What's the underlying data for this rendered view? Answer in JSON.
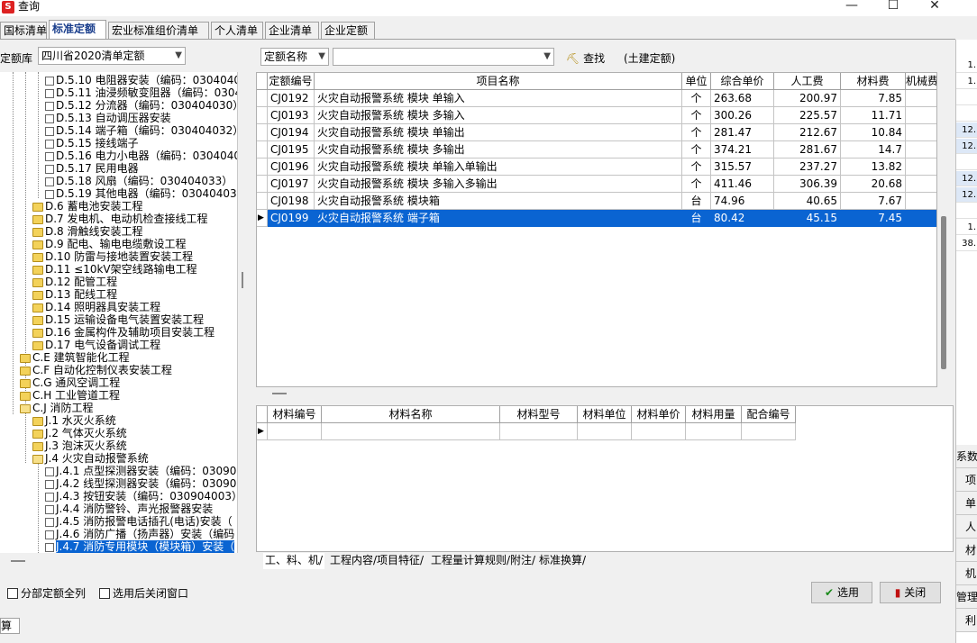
{
  "window": {
    "title": "查询",
    "controls": {
      "minimize": "—",
      "maximize": "☐",
      "close": "✕"
    }
  },
  "tabs": [
    "国标清单",
    "标准定额",
    "宏业标准组价清单",
    "个人清单",
    "企业清单",
    "企业定额"
  ],
  "active_tab_index": 1,
  "filters": {
    "library_label": "定额库",
    "library_value": "四川省2020清单定额",
    "search_field_value": "定额名称",
    "search_text_value": "",
    "find_label": "查找",
    "scope_text": "(土建定额)"
  },
  "tree": {
    "items": [
      {
        "text": "D.5.10 电阻器安装（编码：0304040",
        "level": 3,
        "icon": "doc"
      },
      {
        "text": "D.5.11 油浸频敏变阻器（编码：0304",
        "level": 3,
        "icon": "doc"
      },
      {
        "text": "D.5.12 分流器（编码：030404030）",
        "level": 3,
        "icon": "doc"
      },
      {
        "text": "D.5.13 自动调压器安装",
        "level": 3,
        "icon": "doc"
      },
      {
        "text": "D.5.14 端子箱（编码：030404032）",
        "level": 3,
        "icon": "doc"
      },
      {
        "text": "D.5.15 接线端子",
        "level": 3,
        "icon": "doc"
      },
      {
        "text": "D.5.16 电力小电器（编码：0304040",
        "level": 3,
        "icon": "doc"
      },
      {
        "text": "D.5.17 民用电器",
        "level": 3,
        "icon": "doc"
      },
      {
        "text": "D.5.18 风扇（编码：030404033）",
        "level": 3,
        "icon": "doc"
      },
      {
        "text": "D.5.19 其他电器（编码：030404036",
        "level": 3,
        "icon": "doc"
      },
      {
        "text": "D.6 蓄电池安装工程",
        "level": 2,
        "icon": "folder"
      },
      {
        "text": "D.7 发电机、电动机检查接线工程",
        "level": 2,
        "icon": "folder"
      },
      {
        "text": "D.8 滑触线安装工程",
        "level": 2,
        "icon": "folder"
      },
      {
        "text": "D.9 配电、输电电缆敷设工程",
        "level": 2,
        "icon": "folder"
      },
      {
        "text": "D.10 防雷与接地装置安装工程",
        "level": 2,
        "icon": "folder"
      },
      {
        "text": "D.11 ≤10kV架空线路输电工程",
        "level": 2,
        "icon": "folder"
      },
      {
        "text": "D.12 配管工程",
        "level": 2,
        "icon": "folder"
      },
      {
        "text": "D.13 配线工程",
        "level": 2,
        "icon": "folder"
      },
      {
        "text": "D.14 照明器具安装工程",
        "level": 2,
        "icon": "folder"
      },
      {
        "text": "D.15 运输设备电气装置安装工程",
        "level": 2,
        "icon": "folder"
      },
      {
        "text": "D.16 金属构件及辅助项目安装工程",
        "level": 2,
        "icon": "folder"
      },
      {
        "text": "D.17 电气设备调试工程",
        "level": 2,
        "icon": "folder"
      },
      {
        "text": "C.E 建筑智能化工程",
        "level": 1,
        "icon": "folder"
      },
      {
        "text": "C.F 自动化控制仪表安装工程",
        "level": 1,
        "icon": "folder"
      },
      {
        "text": "C.G 通风空调工程",
        "level": 1,
        "icon": "folder"
      },
      {
        "text": "C.H 工业管道工程",
        "level": 1,
        "icon": "folder"
      },
      {
        "text": "C.J 消防工程",
        "level": 1,
        "icon": "openfolder"
      },
      {
        "text": "J.1 水灭火系统",
        "level": 2,
        "icon": "folder"
      },
      {
        "text": "J.2 气体灭火系统",
        "level": 2,
        "icon": "folder"
      },
      {
        "text": "J.3 泡沫灭火系统",
        "level": 2,
        "icon": "folder"
      },
      {
        "text": "J.4 火灾自动报警系统",
        "level": 2,
        "icon": "openfolder"
      },
      {
        "text": "J.4.1 点型探测器安装（编码：03090",
        "level": 3,
        "icon": "doc"
      },
      {
        "text": "J.4.2 线型探测器安装（编码：03090",
        "level": 3,
        "icon": "doc"
      },
      {
        "text": "J.4.3 按钮安装（编码：030904003）",
        "level": 3,
        "icon": "doc"
      },
      {
        "text": "J.4.4 消防警铃、声光报警器安装",
        "level": 3,
        "icon": "doc"
      },
      {
        "text": "J.4.5 消防报警电话插孔(电话)安装（",
        "level": 3,
        "icon": "doc"
      },
      {
        "text": "J.4.6 消防广播（扬声器）安装（编码",
        "level": 3,
        "icon": "doc"
      },
      {
        "text": "J.4.7 消防专用模块（模块箱）安装（",
        "level": 3,
        "icon": "doc",
        "selected": true
      }
    ]
  },
  "quota_table": {
    "headers": [
      "定额编号",
      "项目名称",
      "单位",
      "综合单价",
      "人工费",
      "材料费",
      "机械费"
    ],
    "rows": [
      {
        "code": "CJ0192",
        "name": "火灾自动报警系统 模块 单输入",
        "unit": "个",
        "price": "263.68",
        "labor": "200.97",
        "material": "7.85",
        "machine": ""
      },
      {
        "code": "CJ0193",
        "name": "火灾自动报警系统 模块 多输入",
        "unit": "个",
        "price": "300.26",
        "labor": "225.57",
        "material": "11.71",
        "machine": ""
      },
      {
        "code": "CJ0194",
        "name": "火灾自动报警系统 模块 单输出",
        "unit": "个",
        "price": "281.47",
        "labor": "212.67",
        "material": "10.84",
        "machine": ""
      },
      {
        "code": "CJ0195",
        "name": "火灾自动报警系统 模块 多输出",
        "unit": "个",
        "price": "374.21",
        "labor": "281.67",
        "material": "14.7",
        "machine": ""
      },
      {
        "code": "CJ0196",
        "name": "火灾自动报警系统 模块 单输入单输出",
        "unit": "个",
        "price": "315.57",
        "labor": "237.27",
        "material": "13.82",
        "machine": ""
      },
      {
        "code": "CJ0197",
        "name": "火灾自动报警系统 模块 多输入多输出",
        "unit": "个",
        "price": "411.46",
        "labor": "306.39",
        "material": "20.68",
        "machine": ""
      },
      {
        "code": "CJ0198",
        "name": "火灾自动报警系统 模块箱",
        "unit": "台",
        "price": "74.96",
        "labor": "40.65",
        "material": "7.67",
        "machine": ""
      },
      {
        "code": "CJ0199",
        "name": "火灾自动报警系统 端子箱",
        "unit": "台",
        "price": "80.42",
        "labor": "45.15",
        "material": "7.45",
        "machine": "",
        "selected": true
      }
    ]
  },
  "material_table": {
    "headers": [
      "材料编号",
      "材料名称",
      "材料型号",
      "材料单位",
      "材料单价",
      "材料用量",
      "配合编号"
    ]
  },
  "bottom_tabs": [
    "工、料、机",
    "工程内容/项目特征",
    "工程量计算规则/附注",
    "标准换算"
  ],
  "options": {
    "show_all_label": "分部定额全列",
    "close_after_select_label": "选用后关闭窗口"
  },
  "buttons": {
    "select": "选用",
    "close": "关闭"
  },
  "right_strip": {
    "values": [
      "1.",
      "1.",
      "",
      "",
      "12.",
      "12.",
      "",
      "12.",
      "12.",
      "",
      "1.",
      "38."
    ],
    "labels": [
      "系数",
      "项",
      "单",
      "人",
      "材",
      "机",
      "管理",
      "利"
    ]
  },
  "bottom_left_tab": "算"
}
